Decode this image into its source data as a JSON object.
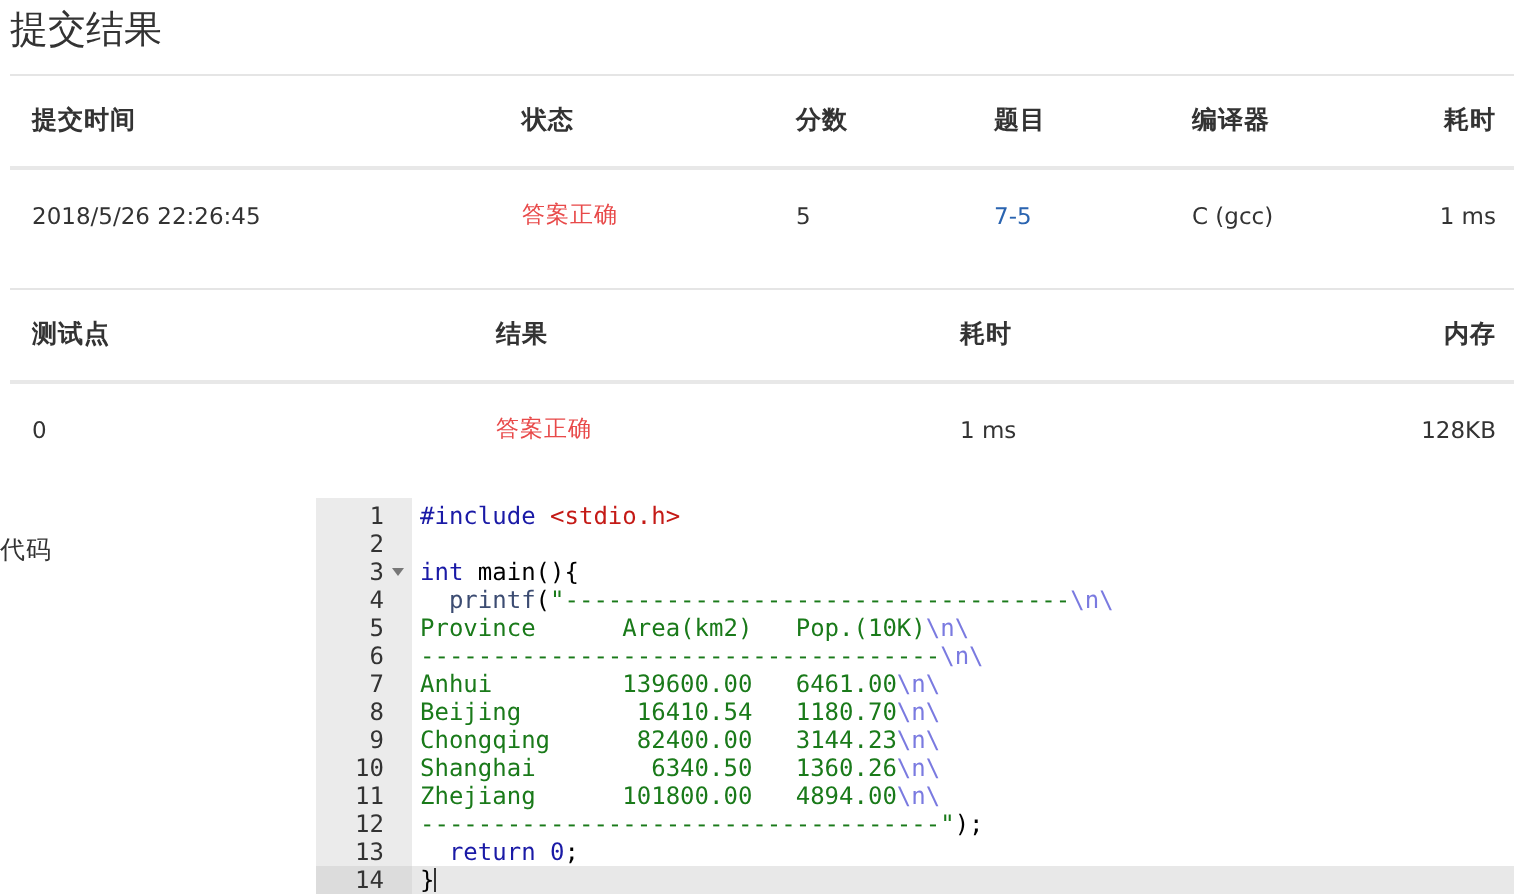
{
  "title": "提交结果",
  "submission_table": {
    "columns": [
      {
        "label": "提交时间"
      },
      {
        "label": "状态"
      },
      {
        "label": "分数"
      },
      {
        "label": "题目"
      },
      {
        "label": "编译器"
      },
      {
        "label": "耗时"
      }
    ],
    "rows": [
      [
        {
          "text": "2018/5/26 22:26:45",
          "kind": "plain"
        },
        {
          "text": "答案正确",
          "kind": "success"
        },
        {
          "text": "5",
          "kind": "plain"
        },
        {
          "text": "7-5",
          "kind": "link"
        },
        {
          "text": "C (gcc)",
          "kind": "plain"
        },
        {
          "text": "1 ms",
          "kind": "plain"
        }
      ]
    ]
  },
  "testcase_table": {
    "columns": [
      {
        "label": "测试点"
      },
      {
        "label": "结果"
      },
      {
        "label": "耗时"
      },
      {
        "label": "内存"
      }
    ],
    "rows": [
      [
        {
          "text": "0",
          "kind": "plain"
        },
        {
          "text": "答案正确",
          "kind": "success"
        },
        {
          "text": "1 ms",
          "kind": "plain"
        },
        {
          "text": "128KB",
          "kind": "plain"
        }
      ]
    ]
  },
  "code_label": "代码",
  "code": {
    "lines": [
      {
        "number": "1",
        "selected": false,
        "foldable": false,
        "tokens": [
          {
            "kind": "keyword",
            "text": "#include "
          },
          {
            "kind": "header",
            "text": "<stdio.h>"
          }
        ]
      },
      {
        "number": "2",
        "selected": false,
        "foldable": false
      },
      {
        "number": "3",
        "selected": false,
        "foldable": true,
        "tokens": [
          {
            "kind": "keyword",
            "text": "int"
          },
          {
            "kind": "plain",
            "text": " main(){"
          }
        ]
      },
      {
        "number": "4",
        "selected": false,
        "foldable": false,
        "tokens": [
          {
            "kind": "function",
            "text": "  printf"
          },
          {
            "kind": "plain",
            "text": "("
          },
          {
            "kind": "string",
            "text": "\"-----------------------------------"
          },
          {
            "kind": "escape",
            "text": "\\n\\"
          }
        ]
      },
      {
        "number": "5",
        "selected": false,
        "foldable": false,
        "tokens": [
          {
            "kind": "string",
            "text": "Province      Area(km2)   Pop.(10K)"
          },
          {
            "kind": "escape",
            "text": "\\n\\"
          }
        ]
      },
      {
        "number": "6",
        "selected": false,
        "foldable": false,
        "tokens": [
          {
            "kind": "string",
            "text": "------------------------------------"
          },
          {
            "kind": "escape",
            "text": "\\n\\"
          }
        ]
      },
      {
        "number": "7",
        "selected": false,
        "foldable": false,
        "tokens": [
          {
            "kind": "string",
            "text": "Anhui         139600.00   6461.00"
          },
          {
            "kind": "escape",
            "text": "\\n\\"
          }
        ]
      },
      {
        "number": "8",
        "selected": false,
        "foldable": false,
        "tokens": [
          {
            "kind": "string",
            "text": "Beijing        16410.54   1180.70"
          },
          {
            "kind": "escape",
            "text": "\\n\\"
          }
        ]
      },
      {
        "number": "9",
        "selected": false,
        "foldable": false,
        "tokens": [
          {
            "kind": "string",
            "text": "Chongqing      82400.00   3144.23"
          },
          {
            "kind": "escape",
            "text": "\\n\\"
          }
        ]
      },
      {
        "number": "10",
        "selected": false,
        "foldable": false,
        "tokens": [
          {
            "kind": "string",
            "text": "Shanghai        6340.50   1360.26"
          },
          {
            "kind": "escape",
            "text": "\\n\\"
          }
        ]
      },
      {
        "number": "11",
        "selected": false,
        "foldable": false,
        "tokens": [
          {
            "kind": "string",
            "text": "Zhejiang      101800.00   4894.00"
          },
          {
            "kind": "escape",
            "text": "\\n\\"
          }
        ]
      },
      {
        "number": "12",
        "selected": false,
        "foldable": false,
        "tokens": [
          {
            "kind": "string",
            "text": "------------------------------------\""
          },
          {
            "kind": "plain",
            "text": ");"
          }
        ]
      },
      {
        "number": "13",
        "selected": false,
        "foldable": false,
        "tokens": [
          {
            "kind": "keyword",
            "text": "  return "
          },
          {
            "kind": "number",
            "text": "0"
          },
          {
            "kind": "plain",
            "text": ";"
          }
        ]
      },
      {
        "number": "14",
        "selected": true,
        "foldable": false,
        "tokens": [
          {
            "kind": "plain",
            "text": "}"
          }
        ]
      }
    ]
  }
}
